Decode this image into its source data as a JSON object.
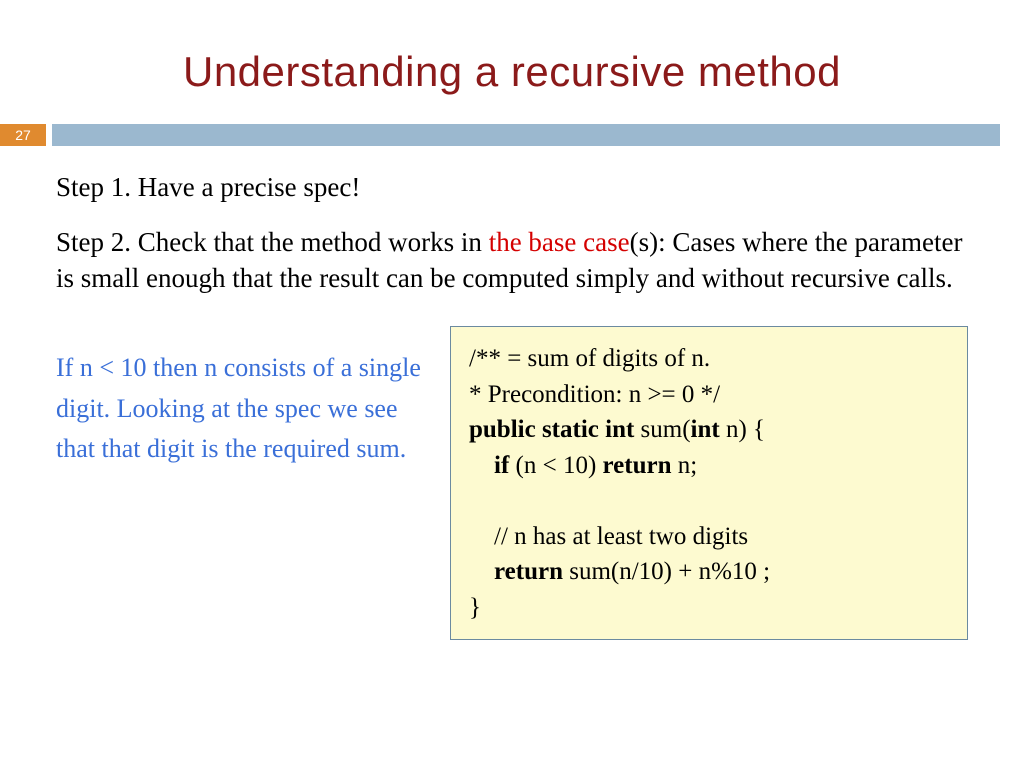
{
  "slide_number": "27",
  "title": "Understanding  a recursive method",
  "step1": "Step 1. Have a precise spec!",
  "step2_pre": "Step 2. Check that the method works in ",
  "step2_base": "the base case",
  "step2_post": "(s): Cases where the parameter is small enough that the result can be computed simply and without recursive calls.",
  "note": "If n < 10 then n consists of a single digit. Looking at the spec we see that that digit is the required sum.",
  "code": {
    "comment1": "/** =  sum of digits of n.",
    "comment2": "    * Precondition:  n >= 0 */",
    "kw_public": "public static int",
    "sig_mid": " sum(",
    "kw_int": "int",
    "sig_end": " n) {",
    "kw_if": "if",
    "if_cond": " (n < 10) ",
    "kw_return1": "return",
    "if_tail": " n;",
    "comment3": "// n has at least two digits",
    "kw_return2": "return",
    "ret_expr": " sum(n/10)  +  n%10 ;",
    "close": "}"
  }
}
